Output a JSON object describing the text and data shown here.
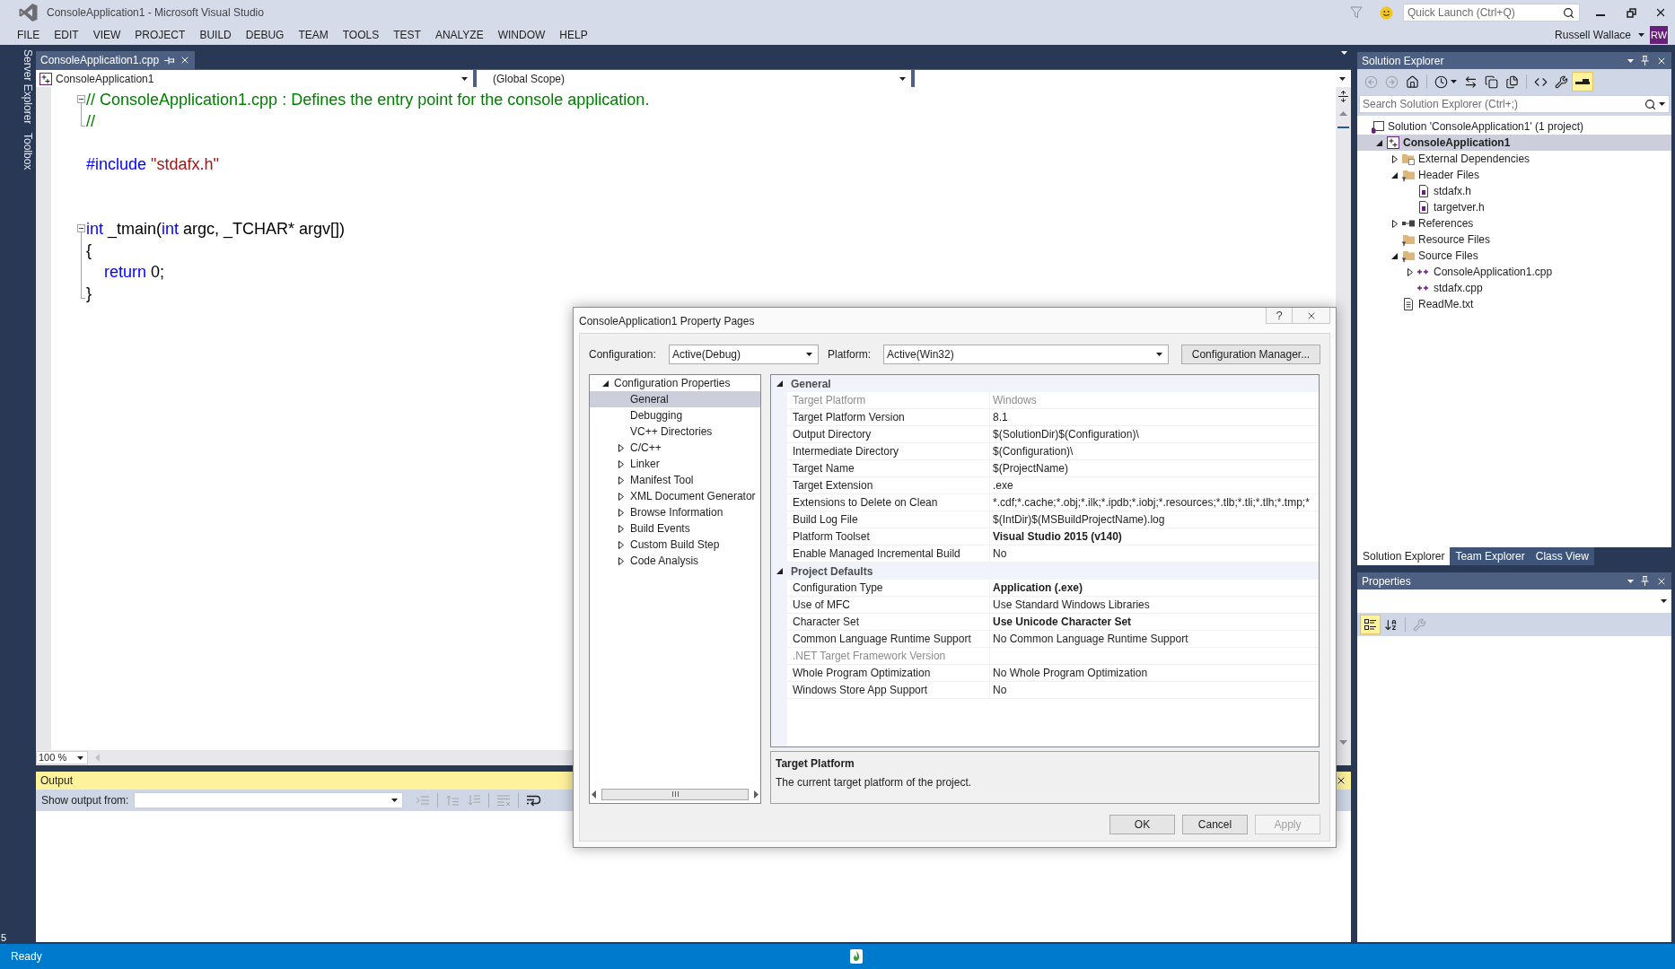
{
  "window": {
    "title": "ConsoleApplication1 - Microsoft Visual Studio"
  },
  "title_bar": {
    "quick_launch": {
      "placeholder": "Quick Launch (Ctrl+Q)"
    },
    "user": {
      "name": "Russell Wallace",
      "initials": "RW"
    }
  },
  "menu": [
    "FILE",
    "EDIT",
    "VIEW",
    "PROJECT",
    "BUILD",
    "DEBUG",
    "TEAM",
    "TOOLS",
    "TEST",
    "ANALYZE",
    "WINDOW",
    "HELP"
  ],
  "side_tabs": [
    "Server Explorer",
    "Toolbox"
  ],
  "left_edge": {
    "text": "5"
  },
  "editor": {
    "tabs": [
      {
        "label": "ConsoleApplication1.cpp",
        "selected": true
      }
    ],
    "project_combo": "ConsoleApplication1",
    "scope_combo": "(Global Scope)",
    "lines": [
      {
        "kind": "code",
        "fold_start": true,
        "tokens": [
          {
            "kind": "comment",
            "text": "// ConsoleApplication1.cpp : Defines the entry point for the console application."
          }
        ]
      },
      {
        "kind": "code",
        "fold_end": true,
        "tokens": [
          {
            "kind": "comment",
            "text": "//"
          }
        ]
      },
      {
        "kind": "blank"
      },
      {
        "kind": "code",
        "tokens": [
          {
            "kind": "keyword",
            "text": "#include"
          },
          {
            "kind": "string",
            "text": " \"stdafx.h\""
          }
        ]
      },
      {
        "kind": "blank"
      },
      {
        "kind": "blank"
      },
      {
        "kind": "code",
        "fold_start": true,
        "tokens": [
          {
            "kind": "keyword",
            "text": "int"
          },
          {
            "kind": "plain",
            "text": " _tmain("
          },
          {
            "kind": "keyword",
            "text": "int"
          },
          {
            "kind": "plain",
            "text": " argc, _TCHAR* argv[])"
          }
        ]
      },
      {
        "kind": "code",
        "tokens": [
          {
            "kind": "plain",
            "text": "{"
          }
        ]
      },
      {
        "kind": "code",
        "tokens": [
          {
            "kind": "keyword",
            "text": "    return"
          },
          {
            "kind": "plain",
            "text": " 0;"
          }
        ]
      },
      {
        "kind": "code",
        "fold_end": true,
        "tokens": [
          {
            "kind": "plain",
            "text": "}"
          }
        ]
      }
    ],
    "zoom": "100 %"
  },
  "output": {
    "title": "Output",
    "source_label": "Show output from:",
    "toolbar": [
      {
        "kind": "goto",
        "disabled": true
      },
      {
        "kind": "separator"
      },
      {
        "kind": "previous",
        "disabled": true
      },
      {
        "kind": "next",
        "disabled": true
      },
      {
        "kind": "separator"
      },
      {
        "kind": "clear",
        "disabled": true
      },
      {
        "kind": "separator"
      },
      {
        "kind": "wrap",
        "disabled": false
      }
    ]
  },
  "status_bar": {
    "text": "Ready"
  },
  "solution_explorer": {
    "title": "Solution Explorer",
    "toolbar": [
      {
        "kind": "back",
        "disabled": true,
        "on": false
      },
      {
        "kind": "forward",
        "disabled": true,
        "on": false
      },
      {
        "kind": "home",
        "disabled": false,
        "on": false
      },
      {
        "kind": "separator"
      },
      {
        "kind": "history",
        "disabled": false,
        "on": false
      },
      {
        "kind": "sync",
        "disabled": false,
        "on": false
      },
      {
        "kind": "collapse",
        "disabled": false,
        "on": false
      },
      {
        "kind": "show_all",
        "disabled": false,
        "on": false
      },
      {
        "kind": "separator"
      },
      {
        "kind": "view_code",
        "disabled": false,
        "on": false
      },
      {
        "kind": "properties",
        "disabled": false,
        "on": false
      },
      {
        "kind": "preview",
        "disabled": false,
        "on": true
      }
    ],
    "search": {
      "placeholder": "Search Solution Explorer (Ctrl+;)"
    },
    "tree": [
      {
        "kind": "solution",
        "label": "Solution 'ConsoleApplication1' (1 project)",
        "selected": false,
        "children": [
          {
            "kind": "project",
            "label": "ConsoleApplication1",
            "expanded": true,
            "selected": true,
            "children": [
              {
                "kind": "dependencies",
                "label": "External Dependencies",
                "expanded": false,
                "selected": false
              },
              {
                "kind": "filter",
                "label": "Header Files",
                "expanded": true,
                "selected": false,
                "children": [
                  {
                    "kind": "header",
                    "label": "stdafx.h",
                    "selected": false
                  },
                  {
                    "kind": "header",
                    "label": "targetver.h",
                    "selected": false
                  }
                ]
              },
              {
                "kind": "references",
                "label": "References",
                "expanded": false,
                "selected": false
              },
              {
                "kind": "filter",
                "label": "Resource Files",
                "selected": false
              },
              {
                "kind": "filter",
                "label": "Source Files",
                "expanded": true,
                "selected": false,
                "children": [
                  {
                    "kind": "source",
                    "label": "ConsoleApplication1.cpp",
                    "expanded": false,
                    "selected": false
                  },
                  {
                    "kind": "source",
                    "label": "stdafx.cpp",
                    "selected": false
                  }
                ]
              },
              {
                "kind": "text",
                "label": "ReadMe.txt",
                "selected": false
              }
            ]
          }
        ]
      }
    ],
    "tabs": [
      {
        "label": "Solution Explorer",
        "selected": true
      },
      {
        "label": "Team Explorer",
        "selected": false
      },
      {
        "label": "Class View",
        "selected": false
      }
    ]
  },
  "properties": {
    "title": "Properties",
    "toolbar": [
      {
        "kind": "categorized",
        "disabled": false,
        "on": true
      },
      {
        "kind": "alphabetical",
        "disabled": false,
        "on": false
      },
      {
        "kind": "separator"
      },
      {
        "kind": "property_pages",
        "disabled": true,
        "on": false
      }
    ]
  },
  "dialog": {
    "title": "ConsoleApplication1 Property Pages",
    "help": "?",
    "configuration": {
      "label": "Configuration:",
      "value": "Active(Debug)"
    },
    "platform": {
      "label": "Platform:",
      "value": "Active(Win32)"
    },
    "manager_button": "Configuration Manager...",
    "tree": [
      {
        "label": "Configuration Properties",
        "expanded": true,
        "selected": false,
        "children": [
          {
            "label": "General",
            "selected": true
          },
          {
            "label": "Debugging",
            "selected": false
          },
          {
            "label": "VC++ Directories",
            "selected": false
          },
          {
            "label": "C/C++",
            "expanded": false,
            "selected": false
          },
          {
            "label": "Linker",
            "expanded": false,
            "selected": false
          },
          {
            "label": "Manifest Tool",
            "expanded": false,
            "selected": false
          },
          {
            "label": "XML Document Generator",
            "expanded": false,
            "selected": false
          },
          {
            "label": "Browse Information",
            "expanded": false,
            "selected": false
          },
          {
            "label": "Build Events",
            "expanded": false,
            "selected": false
          },
          {
            "label": "Custom Build Step",
            "expanded": false,
            "selected": false
          },
          {
            "label": "Code Analysis",
            "expanded": false,
            "selected": false
          }
        ]
      }
    ],
    "grid": [
      {
        "title": "General",
        "expanded": true,
        "rows": [
          {
            "name": "Target Platform",
            "value": "Windows",
            "disabled": true,
            "bold": false
          },
          {
            "name": "Target Platform Version",
            "value": "8.1",
            "disabled": false,
            "bold": false
          },
          {
            "name": "Output Directory",
            "value": "$(SolutionDir)$(Configuration)\\",
            "disabled": false,
            "bold": false
          },
          {
            "name": "Intermediate Directory",
            "value": "$(Configuration)\\",
            "disabled": false,
            "bold": false
          },
          {
            "name": "Target Name",
            "value": "$(ProjectName)",
            "disabled": false,
            "bold": false
          },
          {
            "name": "Target Extension",
            "value": ".exe",
            "disabled": false,
            "bold": false
          },
          {
            "name": "Extensions to Delete on Clean",
            "value": "*.cdf;*.cache;*.obj;*.ilk;*.ipdb;*.iobj;*.resources;*.tlb;*.tli;*.tlh;*.tmp;*",
            "disabled": false,
            "bold": false
          },
          {
            "name": "Build Log File",
            "value": "$(IntDir)$(MSBuildProjectName).log",
            "disabled": false,
            "bold": false
          },
          {
            "name": "Platform Toolset",
            "value": "Visual Studio 2015 (v140)",
            "disabled": false,
            "bold": true
          },
          {
            "name": "Enable Managed Incremental Build",
            "value": "No",
            "disabled": false,
            "bold": false
          }
        ]
      },
      {
        "title": "Project Defaults",
        "expanded": true,
        "rows": [
          {
            "name": "Configuration Type",
            "value": "Application (.exe)",
            "disabled": false,
            "bold": true
          },
          {
            "name": "Use of MFC",
            "value": "Use Standard Windows Libraries",
            "disabled": false,
            "bold": false
          },
          {
            "name": "Character Set",
            "value": "Use Unicode Character Set",
            "disabled": false,
            "bold": true
          },
          {
            "name": "Common Language Runtime Support",
            "value": "No Common Language Runtime Support",
            "disabled": false,
            "bold": false
          },
          {
            "name": ".NET Target Framework Version",
            "disabled": true
          },
          {
            "name": "Whole Program Optimization",
            "value": "No Whole Program Optimization",
            "disabled": false,
            "bold": false
          },
          {
            "name": "Windows Store App Support",
            "value": "No",
            "disabled": false,
            "bold": false
          }
        ]
      }
    ],
    "description": {
      "title": "Target Platform",
      "text": "The current target platform of the project."
    },
    "buttons": [
      {
        "label": "OK",
        "disabled": false
      },
      {
        "label": "Cancel",
        "disabled": false
      },
      {
        "label": "Apply",
        "disabled": true
      }
    ]
  }
}
